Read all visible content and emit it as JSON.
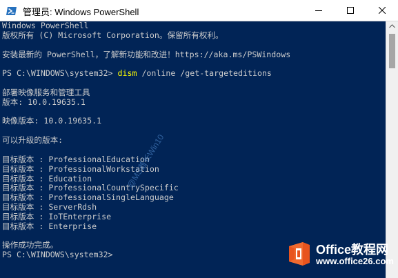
{
  "window": {
    "title": "管理员: Windows PowerShell",
    "minimize_icon": "minimize-icon",
    "maximize_icon": "maximize-icon",
    "close_icon": "close-icon"
  },
  "console": {
    "prompt": "PS C:\\WINDOWS\\system32>",
    "command_name": "dism",
    "command_args": "/online /get-targeteditions",
    "lines": {
      "l1": "Windows PowerShell",
      "l2": "版权所有 (C) Microsoft Corporation。保留所有权利。",
      "l3": "安装最新的 PowerShell，了解新功能和改进！https://aka.ms/PSWindows",
      "l5": "部署映像服务和管理工具",
      "l6": "版本: 10.0.19635.1",
      "l7": "映像版本: 10.0.19635.1",
      "l8": "可以升级的版本:",
      "e1": "目标版本 : ProfessionalEducation",
      "e2": "目标版本 : ProfessionalWorkstation",
      "e3": "目标版本 : Education",
      "e4": "目标版本 : ProfessionalCountrySpecific",
      "e5": "目标版本 : ProfessionalSingleLanguage",
      "e6": "目标版本 : ServerRdsh",
      "e7": "目标版本 : IoTEnterprise",
      "e8": "目标版本 : Enterprise",
      "done": "操作成功完成。"
    }
  },
  "watermark": {
    "text": "@MS酋长Win10"
  },
  "brand": {
    "name": "Office教程网",
    "url": "www.office26.com"
  },
  "colors": {
    "console_bg": "#012456",
    "console_fg": "#cccccc",
    "command": "#ffff00",
    "brand_orange": "#e8541e"
  }
}
